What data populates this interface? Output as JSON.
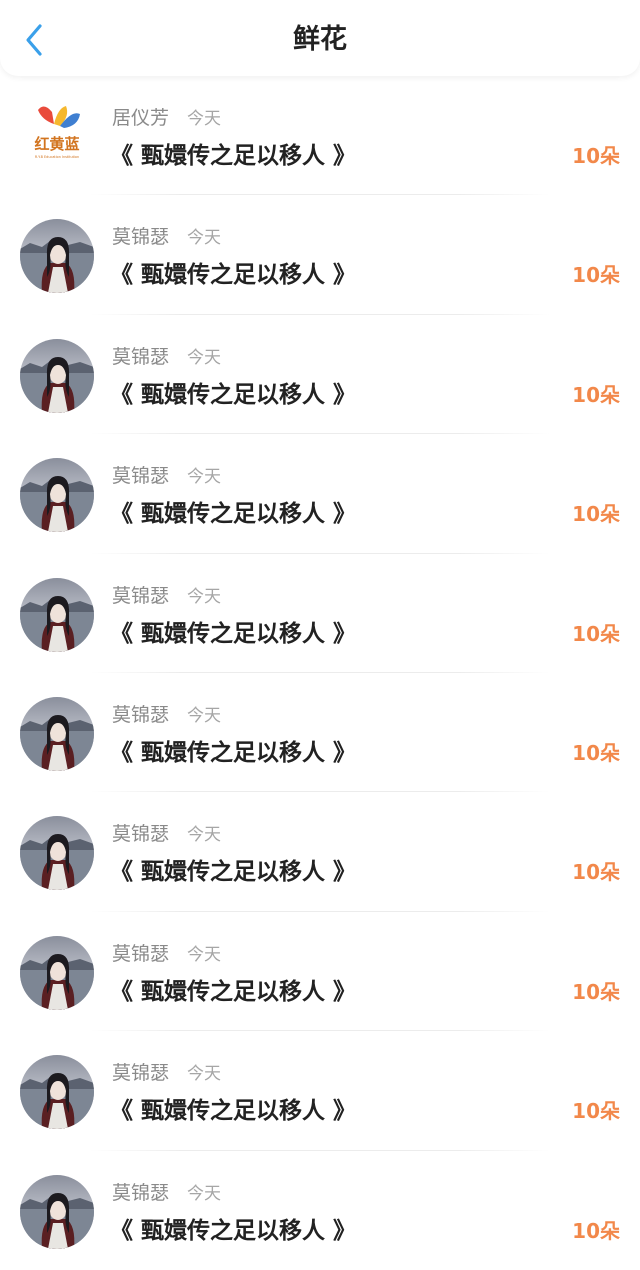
{
  "header": {
    "title": "鲜花",
    "back_icon": "chevron-left-icon",
    "accent_color": "#3aa0ea"
  },
  "items": [
    {
      "name": "居仪芳",
      "date": "今天",
      "title": "《 甄嬛传之足以移人 》",
      "count": "10朵",
      "avatar": "logo",
      "logo_text": "红黄蓝",
      "logo_subtext": "R.Y.B Education Institution"
    },
    {
      "name": "莫锦瑟",
      "date": "今天",
      "title": "《 甄嬛传之足以移人 》",
      "count": "10朵",
      "avatar": "photo"
    },
    {
      "name": "莫锦瑟",
      "date": "今天",
      "title": "《 甄嬛传之足以移人 》",
      "count": "10朵",
      "avatar": "photo"
    },
    {
      "name": "莫锦瑟",
      "date": "今天",
      "title": "《 甄嬛传之足以移人 》",
      "count": "10朵",
      "avatar": "photo"
    },
    {
      "name": "莫锦瑟",
      "date": "今天",
      "title": "《 甄嬛传之足以移人 》",
      "count": "10朵",
      "avatar": "photo"
    },
    {
      "name": "莫锦瑟",
      "date": "今天",
      "title": "《 甄嬛传之足以移人 》",
      "count": "10朵",
      "avatar": "photo"
    },
    {
      "name": "莫锦瑟",
      "date": "今天",
      "title": "《 甄嬛传之足以移人 》",
      "count": "10朵",
      "avatar": "photo"
    },
    {
      "name": "莫锦瑟",
      "date": "今天",
      "title": "《 甄嬛传之足以移人 》",
      "count": "10朵",
      "avatar": "photo"
    },
    {
      "name": "莫锦瑟",
      "date": "今天",
      "title": "《 甄嬛传之足以移人 》",
      "count": "10朵",
      "avatar": "photo"
    },
    {
      "name": "莫锦瑟",
      "date": "今天",
      "title": "《 甄嬛传之足以移人 》",
      "count": "10朵",
      "avatar": "photo"
    }
  ]
}
